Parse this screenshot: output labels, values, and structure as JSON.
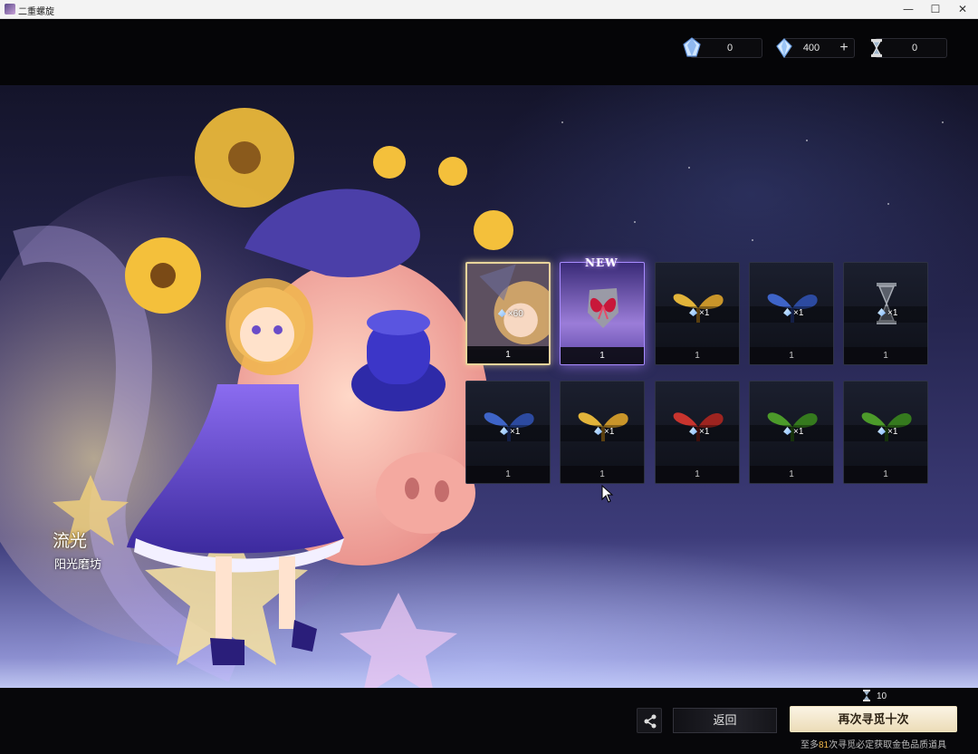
{
  "window": {
    "title": "二重螺旋",
    "minimize": "—",
    "maximize": "☐",
    "close": "✕"
  },
  "currencies": [
    {
      "icon": "blue-crystal-icon",
      "value": "0"
    },
    {
      "icon": "diamond-crystal-icon",
      "value": "400",
      "plus": "+"
    },
    {
      "icon": "hourglass-ticket-icon",
      "value": "0"
    }
  ],
  "character": {
    "title": "流光",
    "subtitle": "阳光磨坊"
  },
  "results": [
    {
      "rarity": "gold",
      "item": "character-portrait",
      "qty": "×60",
      "count": "1"
    },
    {
      "rarity": "purple",
      "item": "red-butterfly-emblem",
      "new": "NEW",
      "qty": "",
      "count": "1"
    },
    {
      "rarity": "common",
      "item": "gold-sprout",
      "qty": "×1",
      "count": "1"
    },
    {
      "rarity": "common",
      "item": "blue-sprout",
      "qty": "×1",
      "count": "1"
    },
    {
      "rarity": "common",
      "item": "grey-hourglass",
      "qty": "×1",
      "count": "1"
    },
    {
      "rarity": "common",
      "item": "blue-sprout",
      "qty": "×1",
      "count": "1"
    },
    {
      "rarity": "common",
      "item": "gold-sprout",
      "qty": "×1",
      "count": "1"
    },
    {
      "rarity": "common",
      "item": "red-sprout",
      "qty": "×1",
      "count": "1"
    },
    {
      "rarity": "common",
      "item": "green-sprout",
      "qty": "×1",
      "count": "1"
    },
    {
      "rarity": "common",
      "item": "green-sprout",
      "qty": "×1",
      "count": "1"
    }
  ],
  "colors": {
    "gold": "#e8d49b",
    "purple": "#a88bff",
    "gold_sprout": "#e2b43a",
    "blue_sprout": "#3e64c8",
    "red_sprout": "#c8342e",
    "green_sprout": "#4c9a2a",
    "accent_highlight": "#f0b64a"
  },
  "bottom": {
    "back_label": "返回",
    "again_label": "再次寻觅十次",
    "cost_value": "10",
    "pity_prefix": "至多",
    "pity_count": "81",
    "pity_suffix": "次寻觅必定获取金色品质道具"
  }
}
